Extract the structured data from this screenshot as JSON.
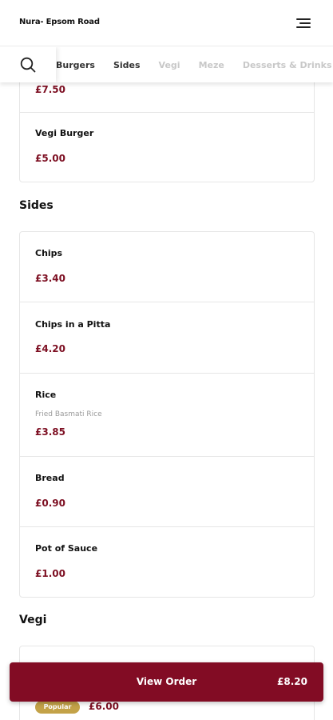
{
  "header": {
    "title": "Nura- Epsom Road",
    "menu_icon": "hamburger-menu-icon"
  },
  "nav": {
    "search_icon": "search-icon",
    "tabs": [
      {
        "label": "Burgers",
        "active": true
      },
      {
        "label": "Sides",
        "active": true
      },
      {
        "label": "Vegi",
        "active": false
      },
      {
        "label": "Meze",
        "active": false
      },
      {
        "label": "Desserts & Drinks",
        "active": false
      }
    ]
  },
  "burgers": {
    "items": [
      {
        "price": "£7.50"
      },
      {
        "name": "Vegi Burger",
        "price": "£5.00"
      }
    ]
  },
  "sides": {
    "title": "Sides",
    "items": [
      {
        "name": "Chips",
        "price": "£3.40"
      },
      {
        "name": "Chips in a Pitta",
        "price": "£4.20"
      },
      {
        "name": "Rice",
        "description": "Fried Basmati Rice",
        "price": "£3.85"
      },
      {
        "name": "Bread",
        "price": "£0.90"
      },
      {
        "name": "Pot of Sauce",
        "price": "£1.00"
      }
    ]
  },
  "vegi": {
    "title": "Vegi",
    "first_item": {
      "badge": "Popular",
      "price": "£6.00"
    }
  },
  "order_bar": {
    "label": "View Order",
    "total": "£8.20"
  },
  "colors": {
    "accent": "#820c24",
    "price": "#7d0f22",
    "badge": "#c3a248"
  }
}
